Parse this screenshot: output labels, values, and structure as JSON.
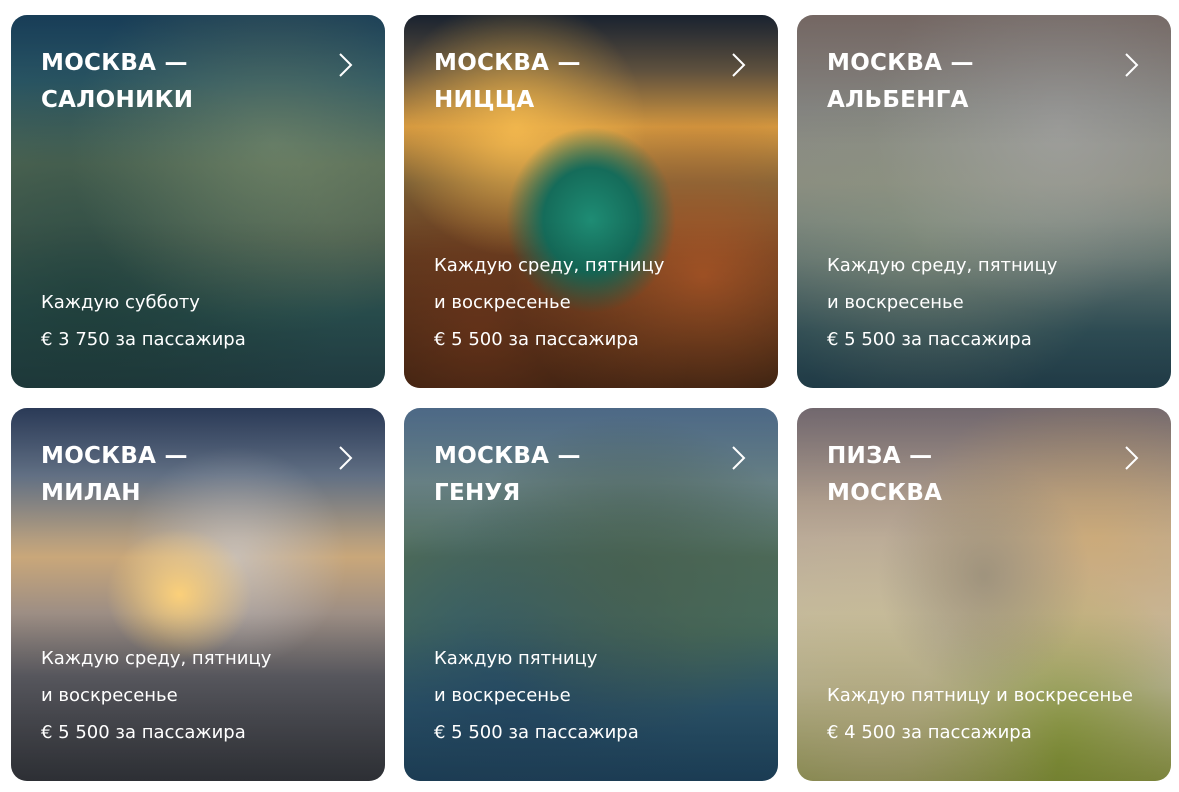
{
  "cards": [
    {
      "title_line1": "МОСКВА —",
      "title_line2": "САЛОНИКИ",
      "schedule_line1": "Каждую субботу",
      "schedule_line2": "",
      "price": "€ 3 750 за пассажира",
      "arrow_icon": "chevron-right-icon"
    },
    {
      "title_line1": "МОСКВА —",
      "title_line2": "НИЦЦА",
      "schedule_line1": "Каждую среду, пятницу",
      "schedule_line2": "и воскресенье",
      "price": "€ 5 500 за пассажира",
      "arrow_icon": "chevron-right-icon"
    },
    {
      "title_line1": "МОСКВА —",
      "title_line2": "АЛЬБЕНГА",
      "schedule_line1": "Каждую среду, пятницу",
      "schedule_line2": "и воскресенье",
      "price": "€ 5 500 за пассажира",
      "arrow_icon": "chevron-right-icon"
    },
    {
      "title_line1": "МОСКВА —",
      "title_line2": "МИЛАН",
      "schedule_line1": "Каждую среду, пятницу",
      "schedule_line2": "и воскресенье",
      "price": "€ 5 500 за пассажира",
      "arrow_icon": "chevron-right-icon"
    },
    {
      "title_line1": "МОСКВА —",
      "title_line2": "ГЕНУЯ",
      "schedule_line1": "Каждую пятницу",
      "schedule_line2": "и воскресенье",
      "price": "€ 5 500 за пассажира",
      "arrow_icon": "chevron-right-icon"
    },
    {
      "title_line1": "ПИЗА —",
      "title_line2": "МОСКВА",
      "schedule_line1": "Каждую пятницу и воскресенье",
      "schedule_line2": "",
      "price": "€ 4 500 за пассажира",
      "arrow_icon": "chevron-right-icon"
    }
  ]
}
